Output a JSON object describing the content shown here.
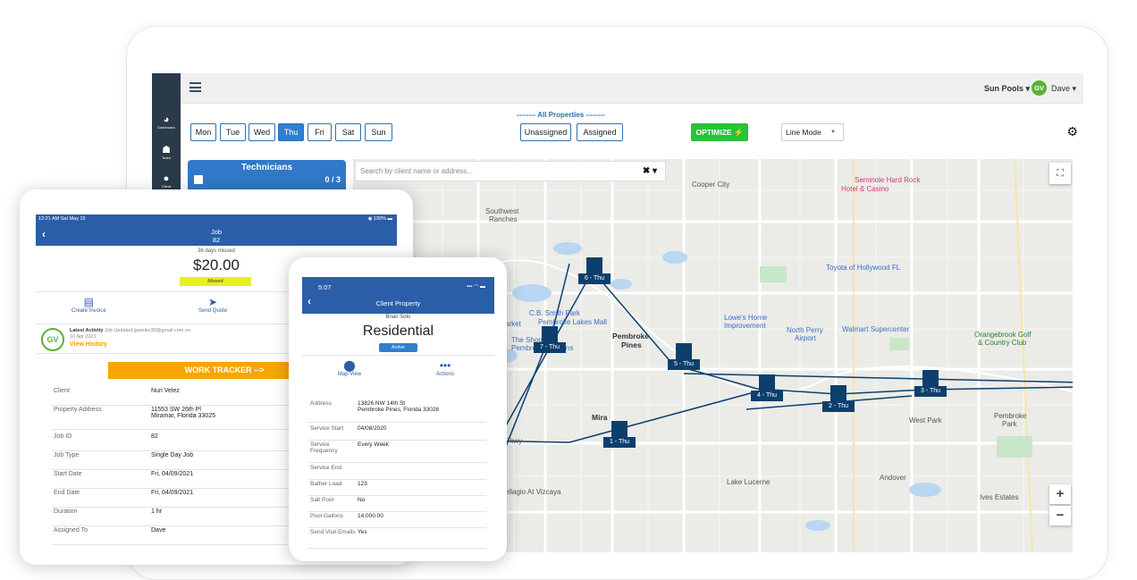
{
  "web": {
    "sidebar": [
      {
        "icon": "dashboard-icon",
        "label": "Dashboard"
      },
      {
        "icon": "team-icon",
        "label": "Team"
      },
      {
        "icon": "client-icon",
        "label": "Client"
      }
    ],
    "header": {
      "company": "Sun Pools ▾",
      "initials": "GV",
      "user": "Dave ▾"
    },
    "days": [
      "Mon",
      "Tue",
      "Wed",
      "Thu",
      "Fri",
      "Sat",
      "Sun"
    ],
    "active_day": "Thu",
    "all_properties": "-------- All Properties --------",
    "unassigned": "Unassigned",
    "assigned": "Assigned",
    "optimize": "OPTIMIZE ⚡",
    "line_mode": "Line Mode",
    "technicians": {
      "title": "Technicians",
      "count": "0 / 3"
    },
    "search_placeholder": "Search by client name or address...",
    "map_labels": {
      "cooper": "Cooper City",
      "seminole": "Seminole Hard Rock",
      "seminole2": "Hotel & Casino",
      "sw_ranches": "Southwest",
      "sw_ranches2": "Ranches",
      "toyota": "Toyota of Hollywood FL",
      "lowes": "Lowe's Home",
      "lowes2": "Improvement",
      "northperry": "North Perry",
      "northperry2": "Airport",
      "walmart": "Walmart Supercenter",
      "orangebrook": "Orangebrook Golf",
      "orangebrook2": "& Country Club",
      "pembroke": "Pembroke",
      "pembroke2": "Pines",
      "smithpark": "C.B. Smith Park",
      "lakesmall": "Pembroke Lakes Mall",
      "shops": "The Shops at",
      "shops2": "Pembroke Gardens",
      "market": "arket",
      "mira": "Mira",
      "westpark": "West Park",
      "pembrokepark": "Pembroke",
      "pembrokepark2": "Park",
      "andover": "Andover",
      "lakelucerne": "Lake Lucerne",
      "ivesestates": "Ives Estates",
      "vizcaya": "ellagio At Vizcaya",
      "pkwy": "Pkwy"
    },
    "pins": [
      "6 - Thu",
      "7 - Thu",
      "5 - Thu",
      "4 - Thu",
      "2 - Thu",
      "3 - Thu",
      "1 - Thu"
    ],
    "zoom_in": "+",
    "zoom_out": "−"
  },
  "tablet": {
    "status_time": "12:21 AM  Sat May 15",
    "battery": "100%",
    "title": "Job",
    "number": "82",
    "missed_days": "36 days missed",
    "price": "$20.00",
    "status": "Missed",
    "create_invoice": "Create Invoice",
    "send_quote": "Send Quote",
    "initials": "GV",
    "activity_label": "Latest Activity",
    "activity_text": "Job Updated gavelez30@gmail.com on",
    "activity_date": "10 Apr 2021",
    "view_history": "View History",
    "work_tracker": "WORK TRACKER -->",
    "rows": [
      {
        "k": "Client",
        "v": "Nuri Velez"
      },
      {
        "k": "Property Address",
        "v": "11553 SW 26th Pl",
        "v2": "Miramar, Florida 33025"
      },
      {
        "k": "Job ID",
        "v": "82"
      },
      {
        "k": "Job Type",
        "v": "Single Day Job"
      },
      {
        "k": "Start Date",
        "v": "Fri, 04/09/2021"
      },
      {
        "k": "End Date",
        "v": "Fri, 04/09/2021"
      },
      {
        "k": "Duration",
        "v": "1 hr"
      },
      {
        "k": "Assigned To",
        "v": "Dave"
      }
    ]
  },
  "phone": {
    "time": "5:07",
    "title": "Client Property",
    "client": "Brian Soto",
    "type": "Residential",
    "status": "Active",
    "map_view": "Map View",
    "actions": "Actions",
    "rows": [
      {
        "k": "Address",
        "v": "13826 NW 14th St",
        "v2": "Pembroke Pines, Florida 33028"
      },
      {
        "k": "Service Start",
        "v": "04/08/2020"
      },
      {
        "k": "Service Frequency",
        "v": "Every Week"
      },
      {
        "k": "Service End",
        "v": ""
      },
      {
        "k": "Bather Load",
        "v": "123"
      },
      {
        "k": "Salt Pool",
        "v": "No"
      },
      {
        "k": "Pool Gallons",
        "v": "14,000.00"
      },
      {
        "k": "Send Visit Emails",
        "v": "Yes"
      }
    ]
  }
}
